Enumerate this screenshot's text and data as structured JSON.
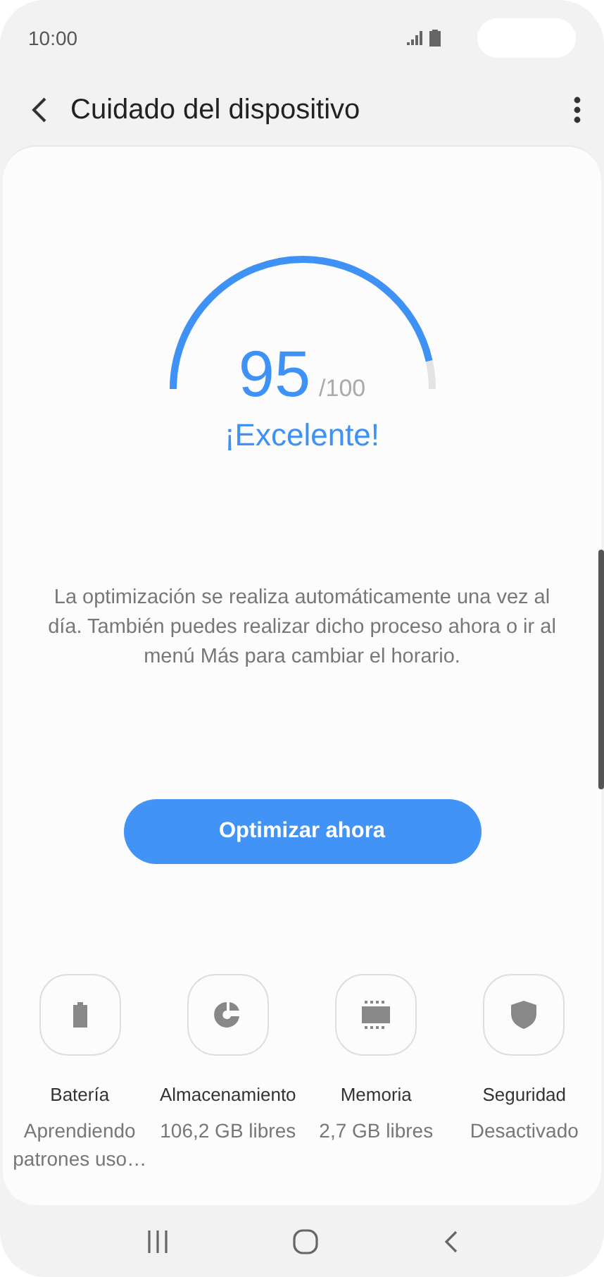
{
  "status_bar": {
    "time": "10:00"
  },
  "header": {
    "title": "Cuidado del dispositivo"
  },
  "score": {
    "value": "95",
    "max": "/100",
    "rating": "¡Excelente!"
  },
  "description": "La optimización se realiza automáticamente una vez al día. También puedes realizar dicho proceso ahora o ir al menú Más para cambiar el horario.",
  "optimize_button": "Optimizar ahora",
  "categories": [
    {
      "kind": "battery",
      "label": "Batería",
      "status": "Aprendiendo patrones uso…"
    },
    {
      "kind": "storage",
      "label": "Almacenamiento",
      "status": "106,2 GB libres"
    },
    {
      "kind": "memory",
      "label": "Memoria",
      "status": "2,7 GB libres"
    },
    {
      "kind": "security",
      "label": "Seguridad",
      "status": "Desactivado"
    }
  ]
}
